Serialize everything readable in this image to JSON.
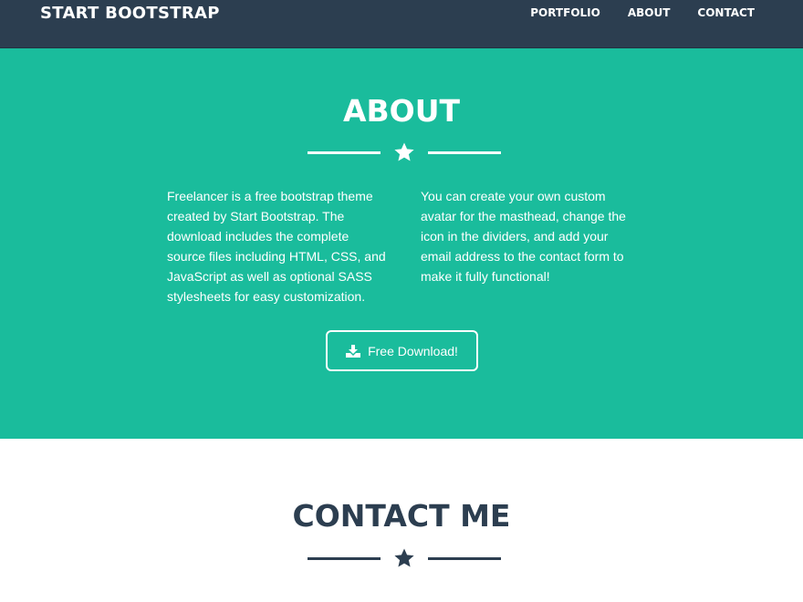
{
  "navbar": {
    "brand": "START BOOTSTRAP",
    "links": [
      "PORTFOLIO",
      "ABOUT",
      "CONTACT"
    ]
  },
  "about": {
    "title": "ABOUT",
    "divider_icon": "star-icon",
    "left_text": "Freelancer is a free bootstrap theme created by Start Bootstrap. The download includes the complete source files including HTML, CSS, and JavaScript as well as optional SASS stylesheets for easy customization.",
    "right_text": "You can create your own custom avatar for the masthead, change the icon in the dividers, and add your email address to the contact form to make it fully functional!",
    "button_label": "Free Download!",
    "button_icon": "download-icon",
    "background": "#1abc9c"
  },
  "contact": {
    "title": "CONTACT ME",
    "divider_icon": "star-icon"
  },
  "colors": {
    "navbar": "#2c3e50",
    "accent": "#1abc9c",
    "dark_text": "#2c3e50"
  }
}
